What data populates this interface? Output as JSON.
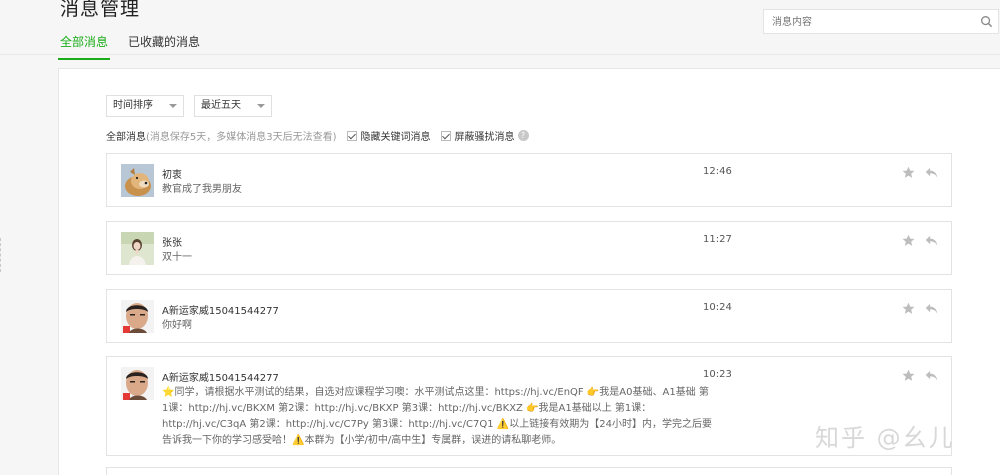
{
  "page": {
    "title": "消息管理"
  },
  "tabs": [
    {
      "label": "全部消息",
      "active": true
    },
    {
      "label": "已收藏的消息",
      "active": false
    }
  ],
  "search": {
    "placeholder": "消息内容",
    "icon": "search-icon"
  },
  "filters": {
    "sort_label": "时间排序",
    "range_label": "最近五天",
    "all_label": "全部消息",
    "all_note": "(消息保存5天，多媒体消息3天后无法查看)",
    "hide_keyword_label": "隐藏关键词消息",
    "block_harass_label": "屏蔽骚扰消息",
    "help_glyph": "?"
  },
  "messages": [
    {
      "name": "初衷",
      "text": "教官成了我男朋友",
      "time": "12:46"
    },
    {
      "name": "张张",
      "text": "双十一",
      "time": "11:27"
    },
    {
      "name": "A新运家威15041544277",
      "text": "你好啊",
      "time": "10:24"
    },
    {
      "name": "A新运家威15041544277",
      "text": "⭐同学，请根据水平测试的结果，自选对应课程学习噢：水平测试点这里：https://hj.vc/EnQF 👉我是A0基础、A1基础 第1课：http://hj.vc/BKXM 第2课：http://hj.vc/BKXP 第3课：http://hj.vc/BKXZ 👉我是A1基础以上 第1课：http://hj.vc/C3qA 第2课：http://hj.vc/C7Py 第3课：http://hj.vc/C7Q1 ⚠️以上链接有效期为【24小时】内，学完之后要告诉我一下你的学习感受哈！⚠️本群为【小学/初中/高中生】专属群，误进的请私聊老师。",
      "time": "10:23"
    }
  ],
  "watermark": "知乎 @幺儿",
  "colors": {
    "accent": "#1aad19",
    "icon_grey": "#bdbdbd"
  }
}
